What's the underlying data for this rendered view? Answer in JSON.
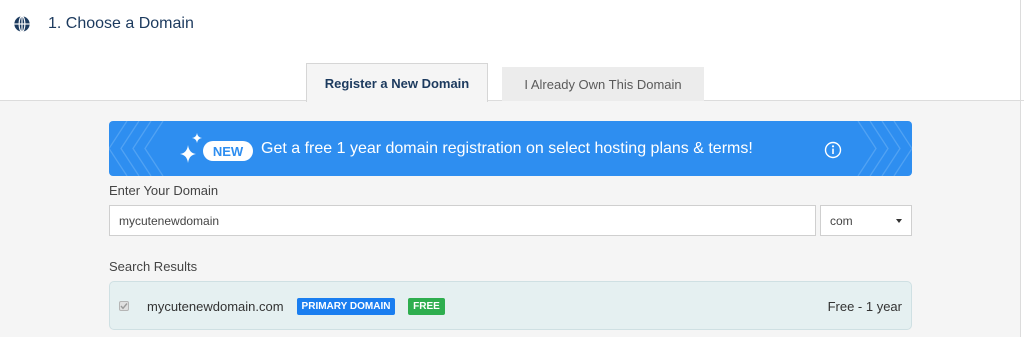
{
  "section": {
    "title": "1. Choose a Domain"
  },
  "tabs": [
    {
      "label": "Register a New Domain",
      "active": true
    },
    {
      "label": "I Already Own This Domain",
      "active": false
    }
  ],
  "promo": {
    "badge": "NEW",
    "text": "Get a free 1 year domain registration on select hosting plans & terms!"
  },
  "domain_form": {
    "label": "Enter Your Domain",
    "value": "mycutenewdomain",
    "tld": "com"
  },
  "results": {
    "label": "Search Results",
    "items": [
      {
        "domain": "mycutenewdomain.com",
        "primary_badge": "PRIMARY DOMAIN",
        "free_badge": "FREE",
        "price": "Free - 1 year",
        "checked": true
      }
    ]
  },
  "colors": {
    "brand_dark": "#1c3a5e",
    "promo_blue": "#2e8ef0",
    "primary_badge": "#1a7ef0",
    "free_badge": "#2eae4f",
    "result_bg": "#e5f0f1"
  },
  "icons": {
    "section": "globe-icon",
    "promo": "sparkle-icon",
    "info": "info-icon",
    "select": "caret-icon",
    "checkbox": "check-icon"
  }
}
